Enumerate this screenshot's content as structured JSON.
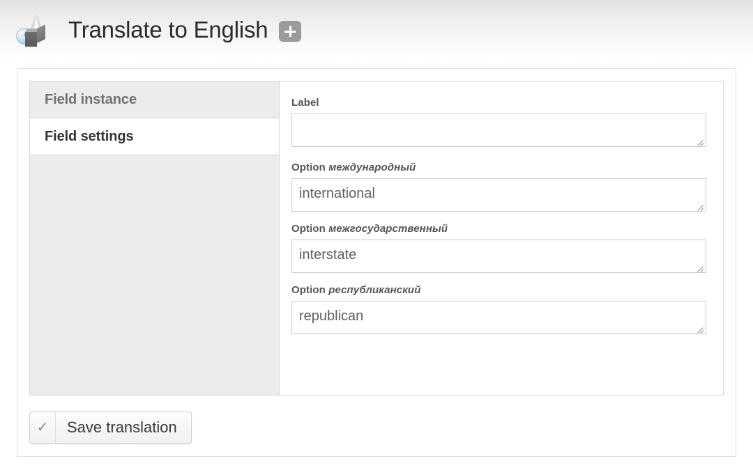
{
  "header": {
    "icon": "3d-shapes-icon",
    "title": "Translate to English",
    "add_button_label": "+"
  },
  "tabs": [
    {
      "id": "field-instance",
      "label": "Field instance",
      "active": false
    },
    {
      "id": "field-settings",
      "label": "Field settings",
      "active": true
    }
  ],
  "form": {
    "fields": [
      {
        "id": "label",
        "label_prefix": "Label",
        "label_term": "",
        "value": "",
        "placeholder": ""
      },
      {
        "id": "option-mezhdunarodnyy",
        "label_prefix": "Option",
        "label_term": "международный",
        "value": "international",
        "placeholder": ""
      },
      {
        "id": "option-mezhgosudarstvennyy",
        "label_prefix": "Option",
        "label_term": "межгосударственный",
        "value": "interstate",
        "placeholder": ""
      },
      {
        "id": "option-respublikanskiy",
        "label_prefix": "Option",
        "label_term": "республиканский",
        "value": "republican",
        "placeholder": ""
      }
    ]
  },
  "actions": {
    "save": {
      "icon": "check-icon",
      "icon_glyph": "✓",
      "label": "Save translation"
    }
  },
  "colors": {
    "page_background": "#ffffff",
    "header_gradient_top": "#e1e1e1",
    "tab_inactive_background": "#ececec",
    "tab_active_background": "#ffffff",
    "border": "#d7d7d7",
    "label_text": "#555555",
    "input_text": "#5f5f5f",
    "add_button": "#9b9b9b"
  }
}
